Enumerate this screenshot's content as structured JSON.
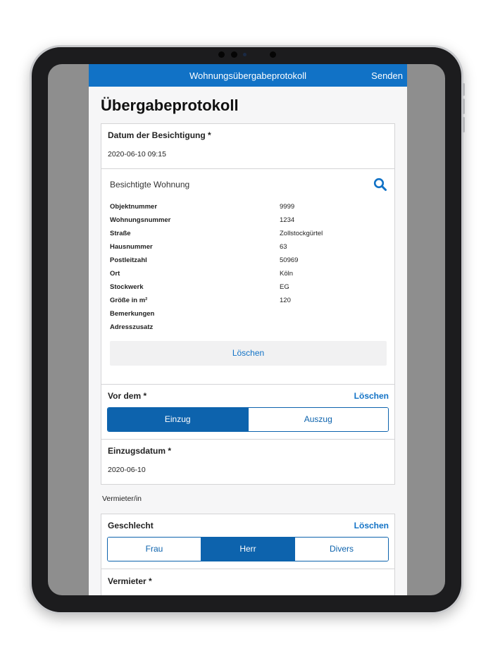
{
  "navbar": {
    "title": "Wohnungsübergabeprotokoll",
    "send_label": "Senden"
  },
  "page": {
    "title": "Übergabeprotokoll"
  },
  "inspection": {
    "date_label": "Datum der Besichtigung *",
    "date_value": "2020-06-10 09:15",
    "apartment_title": "Besichtigte Wohnung",
    "properties": [
      {
        "key": "Objektnummer",
        "value": "9999"
      },
      {
        "key": "Wohnungsnummer",
        "value": "1234"
      },
      {
        "key": "Straße",
        "value": "Zollstockgürtel"
      },
      {
        "key": "Hausnummer",
        "value": "63"
      },
      {
        "key": "Postleitzahl",
        "value": "50969"
      },
      {
        "key": "Ort",
        "value": "Köln"
      },
      {
        "key": "Stockwerk",
        "value": "EG"
      },
      {
        "key": "Größe in m²",
        "value": "120"
      },
      {
        "key": "Bemerkungen",
        "value": ""
      },
      {
        "key": "Adresszusatz",
        "value": ""
      }
    ],
    "delete_label": "Löschen"
  },
  "move": {
    "label": "Vor dem *",
    "clear_label": "Löschen",
    "options": [
      "Einzug",
      "Auszug"
    ],
    "selected": "Einzug",
    "date_label": "Einzugsdatum *",
    "date_value": "2020-06-10"
  },
  "landlord": {
    "section_caption": "Vermieter/in",
    "gender_label": "Geschlecht",
    "clear_label": "Löschen",
    "gender_options": [
      "Frau",
      "Herr",
      "Divers"
    ],
    "gender_selected": "Herr",
    "name_label": "Vermieter *"
  },
  "colors": {
    "accent": "#1172c6",
    "segment_active": "#0d63ad",
    "frame": "#1c1c1e"
  }
}
